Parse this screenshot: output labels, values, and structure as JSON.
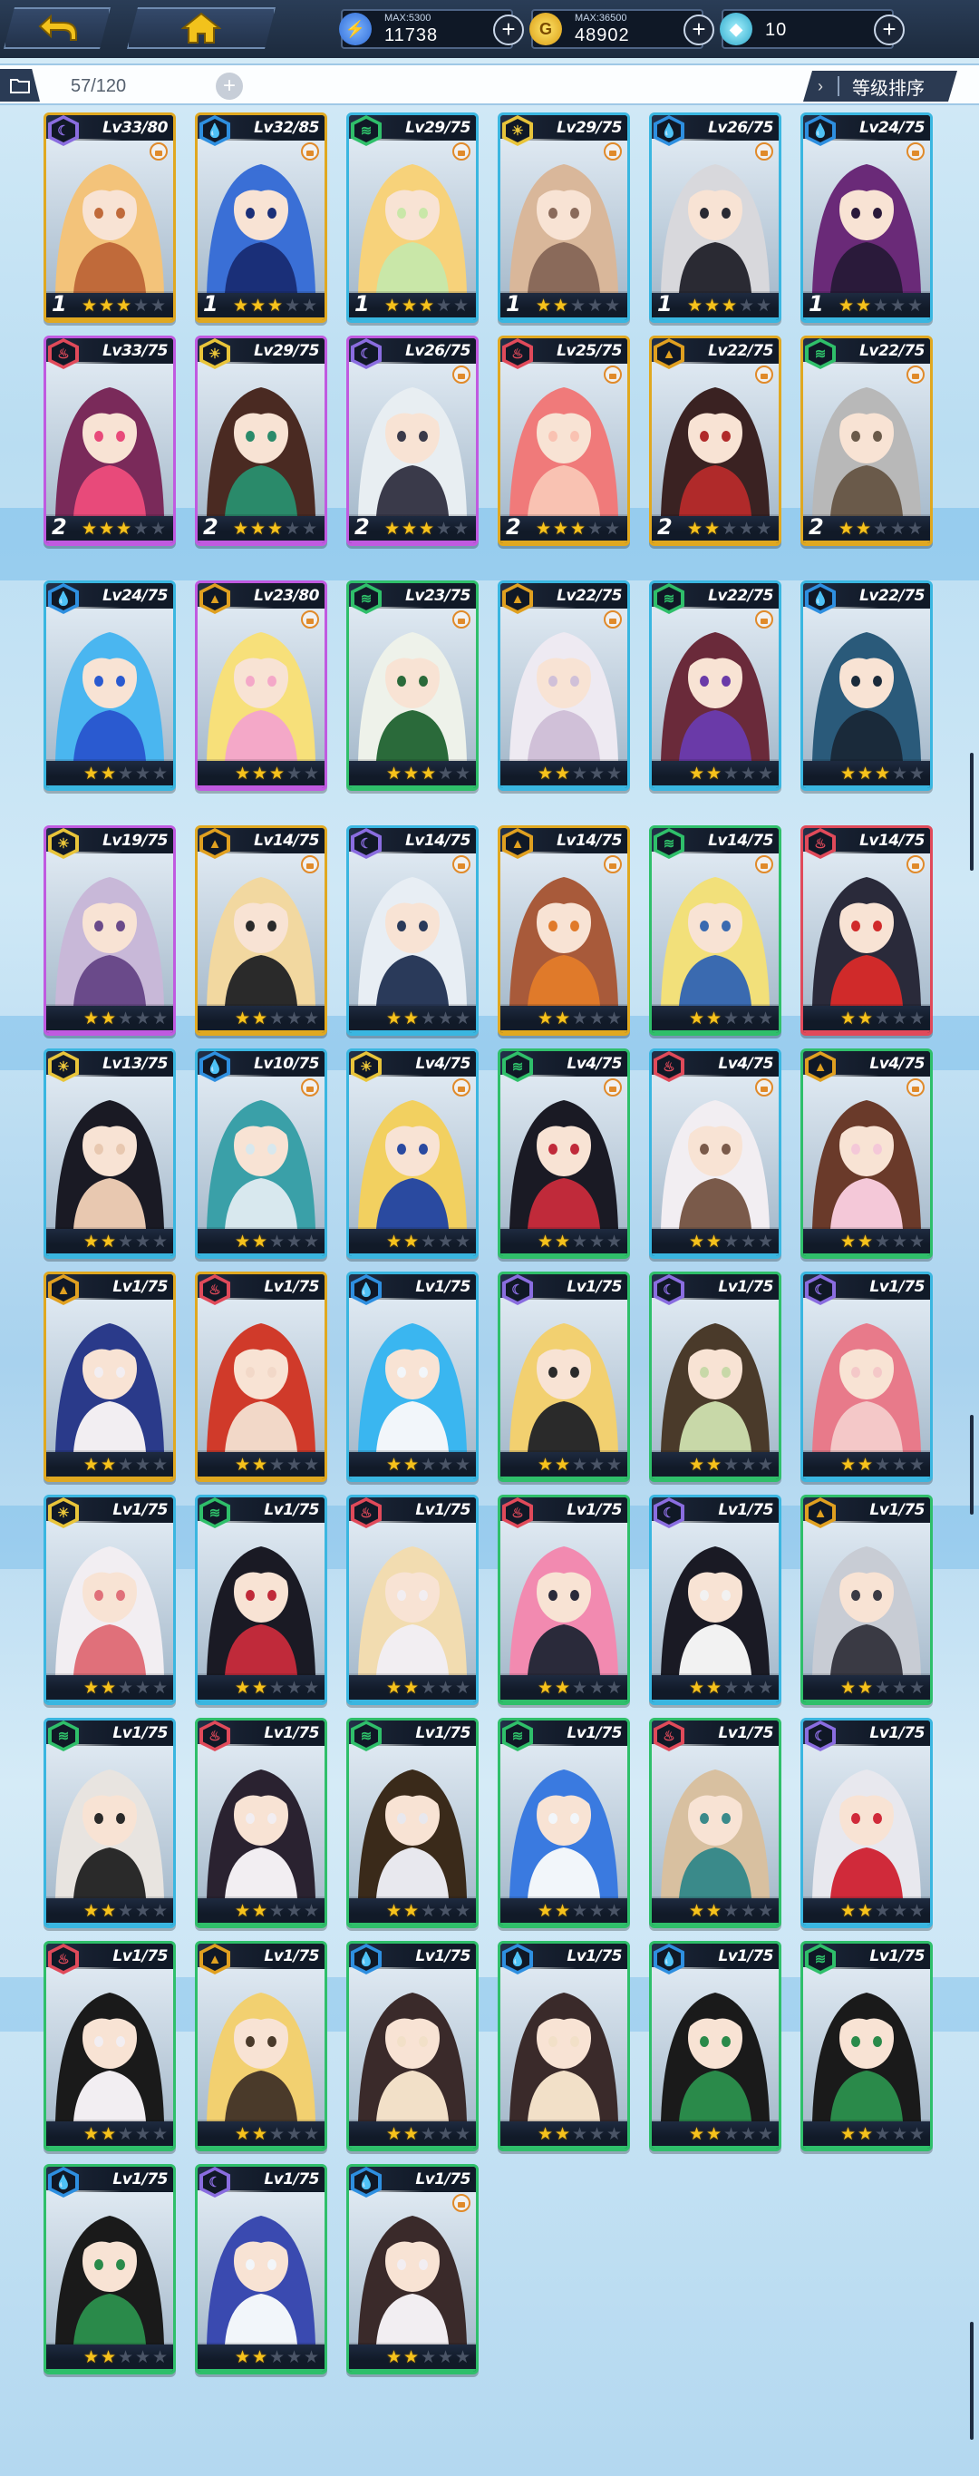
{
  "topbar": {
    "back_icon": "back-arrow-icon",
    "home_icon": "home-icon",
    "energy": {
      "max": "MAX:5300",
      "value": "11738",
      "icon": "energy-icon",
      "color": "#3a7ae0"
    },
    "gold": {
      "max": "MAX:36500",
      "value": "48902",
      "icon": "gold-coin-icon",
      "color": "#e0a818"
    },
    "gem": {
      "max": "",
      "value": "10",
      "icon": "crystal-icon",
      "color": "#2aa6c9"
    }
  },
  "list": {
    "count": "57/120",
    "add_icon": "plus-icon",
    "sort_label": "等级排序"
  },
  "elements": {
    "dark": {
      "icon": "moon-icon",
      "glyph": "☾",
      "color": "#8a6de0"
    },
    "water": {
      "icon": "water-drop-icon",
      "glyph": "💧",
      "color": "#2e8fe0"
    },
    "wind": {
      "icon": "wind-icon",
      "glyph": "≋",
      "color": "#2fbf6a"
    },
    "light": {
      "icon": "sun-icon",
      "glyph": "☀",
      "color": "#e8c43a"
    },
    "fire": {
      "icon": "flame-icon",
      "glyph": "♨",
      "color": "#e04a5a"
    },
    "earth": {
      "icon": "mountain-icon",
      "glyph": "▲",
      "color": "#e0a020"
    }
  },
  "cards": [
    {
      "el": "dark",
      "lv": "Lv33/80",
      "rank": "1",
      "stars": 3,
      "lock": true,
      "frame": "#e0a820",
      "c1": "#f3c37a",
      "c2": "#c06a3a"
    },
    {
      "el": "water",
      "lv": "Lv32/85",
      "rank": "1",
      "stars": 3,
      "lock": true,
      "frame": "#e0a820",
      "c1": "#3a6fd6",
      "c2": "#1a2f78"
    },
    {
      "el": "wind",
      "lv": "Lv29/75",
      "rank": "1",
      "stars": 3,
      "lock": true,
      "frame": "#3ab6e0",
      "c1": "#f7d27a",
      "c2": "#c9e7a8"
    },
    {
      "el": "light",
      "lv": "Lv29/75",
      "rank": "1",
      "stars": 2,
      "lock": true,
      "frame": "#3ab6e0",
      "c1": "#d9b79a",
      "c2": "#8a6a5a"
    },
    {
      "el": "water",
      "lv": "Lv26/75",
      "rank": "1",
      "stars": 3,
      "lock": true,
      "frame": "#3ab6e0",
      "c1": "#d8d8dc",
      "c2": "#2a2a33"
    },
    {
      "el": "water",
      "lv": "Lv24/75",
      "rank": "1",
      "stars": 2,
      "lock": true,
      "frame": "#3ab6e0",
      "c1": "#6a2a78",
      "c2": "#2a1a3a"
    },
    {
      "el": "fire",
      "lv": "Lv33/75",
      "rank": "2",
      "stars": 3,
      "lock": false,
      "frame": "#c05ae0",
      "c1": "#7a2a5a",
      "c2": "#e84a7a"
    },
    {
      "el": "light",
      "lv": "Lv29/75",
      "rank": "2",
      "stars": 3,
      "lock": false,
      "frame": "#c05ae0",
      "c1": "#4a2a22",
      "c2": "#2a8a6a"
    },
    {
      "el": "dark",
      "lv": "Lv26/75",
      "rank": "2",
      "stars": 3,
      "lock": true,
      "frame": "#c05ae0",
      "c1": "#e8eef2",
      "c2": "#3a3a4a"
    },
    {
      "el": "fire",
      "lv": "Lv25/75",
      "rank": "2",
      "stars": 3,
      "lock": true,
      "frame": "#e0a820",
      "c1": "#f07a7a",
      "c2": "#f9c2b2"
    },
    {
      "el": "earth",
      "lv": "Lv22/75",
      "rank": "2",
      "stars": 2,
      "lock": true,
      "frame": "#e0a820",
      "c1": "#3a2222",
      "c2": "#b02a2a"
    },
    {
      "el": "wind",
      "lv": "Lv22/75",
      "rank": "2",
      "stars": 2,
      "lock": true,
      "frame": "#e0a820",
      "c1": "#b8b8b8",
      "c2": "#6a5a4a"
    },
    {
      "el": "water",
      "lv": "Lv24/75",
      "rank": "",
      "stars": 2,
      "lock": false,
      "frame": "#3ab6e0",
      "c1": "#4ab6f0",
      "c2": "#2a5ad0"
    },
    {
      "el": "earth",
      "lv": "Lv23/80",
      "rank": "",
      "stars": 3,
      "lock": true,
      "frame": "#c05ae0",
      "c1": "#f7e07a",
      "c2": "#f4a8c8"
    },
    {
      "el": "wind",
      "lv": "Lv23/75",
      "rank": "",
      "stars": 3,
      "lock": true,
      "frame": "#2fbf6a",
      "c1": "#eef2ea",
      "c2": "#2a6a3a"
    },
    {
      "el": "earth",
      "lv": "Lv22/75",
      "rank": "",
      "stars": 2,
      "lock": true,
      "frame": "#3ab6e0",
      "c1": "#eeeaf2",
      "c2": "#d0c0d8"
    },
    {
      "el": "wind",
      "lv": "Lv22/75",
      "rank": "",
      "stars": 2,
      "lock": true,
      "frame": "#3ab6e0",
      "c1": "#6a2a3a",
      "c2": "#6a3aa8"
    },
    {
      "el": "water",
      "lv": "Lv22/75",
      "rank": "",
      "stars": 3,
      "lock": false,
      "frame": "#3ab6e0",
      "c1": "#2a5a7a",
      "c2": "#1a2a3a"
    },
    {
      "el": "light",
      "lv": "Lv19/75",
      "rank": "",
      "stars": 2,
      "lock": false,
      "frame": "#c05ae0",
      "c1": "#c8b8d8",
      "c2": "#6a4a8a"
    },
    {
      "el": "earth",
      "lv": "Lv14/75",
      "rank": "",
      "stars": 2,
      "lock": true,
      "frame": "#e0a820",
      "c1": "#f2d8a0",
      "c2": "#2a2a2a"
    },
    {
      "el": "dark",
      "lv": "Lv14/75",
      "rank": "",
      "stars": 2,
      "lock": true,
      "frame": "#3ab6e0",
      "c1": "#e8eef4",
      "c2": "#2a3a5a"
    },
    {
      "el": "earth",
      "lv": "Lv14/75",
      "rank": "",
      "stars": 2,
      "lock": true,
      "frame": "#e0a820",
      "c1": "#a85a3a",
      "c2": "#e07a2a"
    },
    {
      "el": "wind",
      "lv": "Lv14/75",
      "rank": "",
      "stars": 2,
      "lock": true,
      "frame": "#2fbf6a",
      "c1": "#f2e07a",
      "c2": "#3a6ab0"
    },
    {
      "el": "fire",
      "lv": "Lv14/75",
      "rank": "",
      "stars": 2,
      "lock": true,
      "frame": "#e04a5a",
      "c1": "#2a2a3a",
      "c2": "#d02a2a"
    },
    {
      "el": "light",
      "lv": "Lv13/75",
      "rank": "",
      "stars": 2,
      "lock": false,
      "frame": "#3ab6e0",
      "c1": "#1a1a24",
      "c2": "#e8c8b0"
    },
    {
      "el": "water",
      "lv": "Lv10/75",
      "rank": "",
      "stars": 2,
      "lock": true,
      "frame": "#3ab6e0",
      "c1": "#3aa0a8",
      "c2": "#d8e8ee"
    },
    {
      "el": "light",
      "lv": "Lv4/75",
      "rank": "",
      "stars": 2,
      "lock": true,
      "frame": "#3ab6e0",
      "c1": "#f2d060",
      "c2": "#2a4aa0"
    },
    {
      "el": "wind",
      "lv": "Lv4/75",
      "rank": "",
      "stars": 2,
      "lock": true,
      "frame": "#2fbf6a",
      "c1": "#1a1a24",
      "c2": "#c02a3a"
    },
    {
      "el": "fire",
      "lv": "Lv4/75",
      "rank": "",
      "stars": 2,
      "lock": true,
      "frame": "#3ab6e0",
      "c1": "#f2eef2",
      "c2": "#7a5a4a"
    },
    {
      "el": "earth",
      "lv": "Lv4/75",
      "rank": "",
      "stars": 2,
      "lock": true,
      "frame": "#2fbf6a",
      "c1": "#6a3a2a",
      "c2": "#f4c8d8"
    },
    {
      "el": "earth",
      "lv": "Lv1/75",
      "rank": "",
      "stars": 2,
      "lock": false,
      "frame": "#e0a820",
      "c1": "#2a3a8a",
      "c2": "#f2eef2"
    },
    {
      "el": "fire",
      "lv": "Lv1/75",
      "rank": "",
      "stars": 2,
      "lock": false,
      "frame": "#e0a820",
      "c1": "#d03a2a",
      "c2": "#f2d8c8"
    },
    {
      "el": "water",
      "lv": "Lv1/75",
      "rank": "",
      "stars": 2,
      "lock": false,
      "frame": "#3ab6e0",
      "c1": "#3ab6f0",
      "c2": "#f2f6fa"
    },
    {
      "el": "dark",
      "lv": "Lv1/75",
      "rank": "",
      "stars": 2,
      "lock": false,
      "frame": "#2fbf6a",
      "c1": "#f2d070",
      "c2": "#2a2a2a"
    },
    {
      "el": "dark",
      "lv": "Lv1/75",
      "rank": "",
      "stars": 2,
      "lock": false,
      "frame": "#2fbf6a",
      "c1": "#4a3a2a",
      "c2": "#c8d8a8"
    },
    {
      "el": "dark",
      "lv": "Lv1/75",
      "rank": "",
      "stars": 2,
      "lock": false,
      "frame": "#3ab6e0",
      "c1": "#e87a8a",
      "c2": "#f4c8c8"
    },
    {
      "el": "light",
      "lv": "Lv1/75",
      "rank": "",
      "stars": 2,
      "lock": false,
      "frame": "#3ab6e0",
      "c1": "#f2eef2",
      "c2": "#e0707a"
    },
    {
      "el": "wind",
      "lv": "Lv1/75",
      "rank": "",
      "stars": 2,
      "lock": false,
      "frame": "#3ab6e0",
      "c1": "#1a1a24",
      "c2": "#c02a3a"
    },
    {
      "el": "fire",
      "lv": "Lv1/75",
      "rank": "",
      "stars": 2,
      "lock": false,
      "frame": "#3ab6e0",
      "c1": "#f2dcb0",
      "c2": "#f2eef2"
    },
    {
      "el": "fire",
      "lv": "Lv1/75",
      "rank": "",
      "stars": 2,
      "lock": false,
      "frame": "#2fbf6a",
      "c1": "#f28ab0",
      "c2": "#2a2a3a"
    },
    {
      "el": "dark",
      "lv": "Lv1/75",
      "rank": "",
      "stars": 2,
      "lock": false,
      "frame": "#3ab6e0",
      "c1": "#1a1a24",
      "c2": "#f2f2f2"
    },
    {
      "el": "earth",
      "lv": "Lv1/75",
      "rank": "",
      "stars": 2,
      "lock": false,
      "frame": "#2fbf6a",
      "c1": "#c8ccd4",
      "c2": "#3a3a44"
    },
    {
      "el": "wind",
      "lv": "Lv1/75",
      "rank": "",
      "stars": 2,
      "lock": false,
      "frame": "#3ab6e0",
      "c1": "#e8e4e0",
      "c2": "#2a2a2a"
    },
    {
      "el": "fire",
      "lv": "Lv1/75",
      "rank": "",
      "stars": 2,
      "lock": false,
      "frame": "#2fbf6a",
      "c1": "#2a2230",
      "c2": "#f2eef2"
    },
    {
      "el": "wind",
      "lv": "Lv1/75",
      "rank": "",
      "stars": 2,
      "lock": false,
      "frame": "#2fbf6a",
      "c1": "#3a2a1a",
      "c2": "#e8e8ee"
    },
    {
      "el": "wind",
      "lv": "Lv1/75",
      "rank": "",
      "stars": 2,
      "lock": false,
      "frame": "#2fbf6a",
      "c1": "#3a7ae0",
      "c2": "#f2f6fa"
    },
    {
      "el": "fire",
      "lv": "Lv1/75",
      "rank": "",
      "stars": 2,
      "lock": false,
      "frame": "#2fbf6a",
      "c1": "#d8c0a0",
      "c2": "#3a8a8a"
    },
    {
      "el": "dark",
      "lv": "Lv1/75",
      "rank": "",
      "stars": 2,
      "lock": false,
      "frame": "#3ab6e0",
      "c1": "#e8e8ee",
      "c2": "#d02a3a"
    },
    {
      "el": "fire",
      "lv": "Lv1/75",
      "rank": "",
      "stars": 2,
      "lock": false,
      "frame": "#2fbf6a",
      "c1": "#1a1a1a",
      "c2": "#f2eef2"
    },
    {
      "el": "earth",
      "lv": "Lv1/75",
      "rank": "",
      "stars": 2,
      "lock": false,
      "frame": "#2fbf6a",
      "c1": "#f2d070",
      "c2": "#4a3a2a"
    },
    {
      "el": "water",
      "lv": "Lv1/75",
      "rank": "",
      "stars": 2,
      "lock": false,
      "frame": "#2fbf6a",
      "c1": "#3a2a2a",
      "c2": "#f2e0c8"
    },
    {
      "el": "water",
      "lv": "Lv1/75",
      "rank": "",
      "stars": 2,
      "lock": false,
      "frame": "#2fbf6a",
      "c1": "#3a2a2a",
      "c2": "#f2e0c8"
    },
    {
      "el": "water",
      "lv": "Lv1/75",
      "rank": "",
      "stars": 2,
      "lock": false,
      "frame": "#2fbf6a",
      "c1": "#1a1a1a",
      "c2": "#2a8a4a"
    },
    {
      "el": "wind",
      "lv": "Lv1/75",
      "rank": "",
      "stars": 2,
      "lock": false,
      "frame": "#2fbf6a",
      "c1": "#1a1a1a",
      "c2": "#2a8a4a"
    },
    {
      "el": "water",
      "lv": "Lv1/75",
      "rank": "",
      "stars": 2,
      "lock": false,
      "frame": "#2fbf6a",
      "c1": "#1a1a1a",
      "c2": "#2a8a4a"
    },
    {
      "el": "dark",
      "lv": "Lv1/75",
      "rank": "",
      "stars": 2,
      "lock": false,
      "frame": "#2fbf6a",
      "c1": "#3a4ab0",
      "c2": "#f2f6fa"
    },
    {
      "el": "water",
      "lv": "Lv1/75",
      "rank": "",
      "stars": 2,
      "lock": true,
      "frame": "#2fbf6a",
      "c1": "#3a2a2a",
      "c2": "#f2eef2"
    }
  ]
}
